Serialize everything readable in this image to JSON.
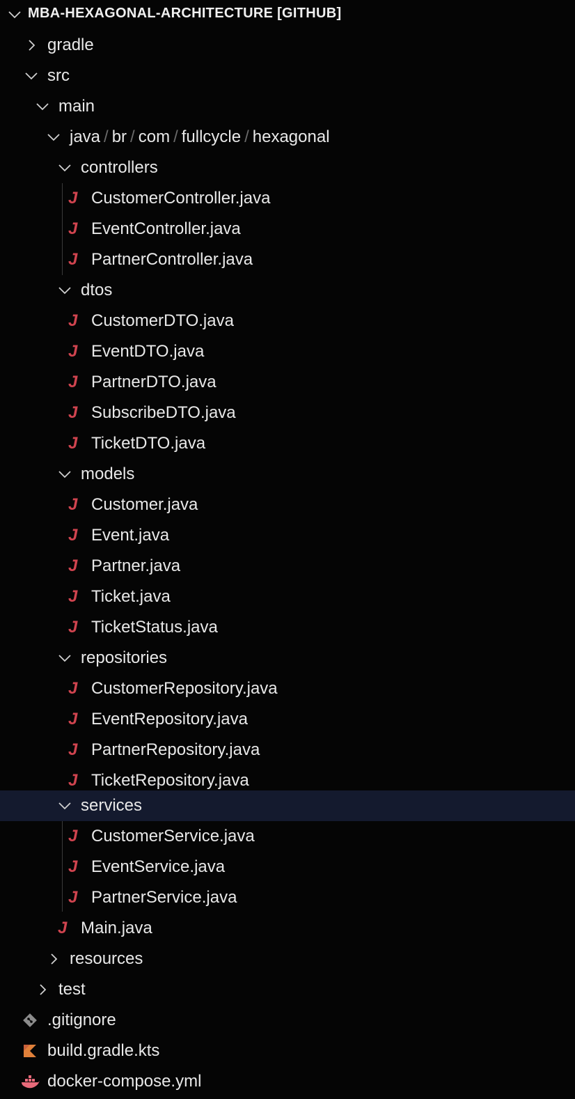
{
  "header": {
    "title": "MBA-HEXAGONAL-ARCHITECTURE [GITHUB]",
    "icon": "chevron-down-icon"
  },
  "colors": {
    "background": "#050505",
    "selected_row": "#141a2e",
    "java_icon": "#d0444f",
    "kotlin_icon": "#e0803a",
    "docker_icon": "#e86a7a"
  },
  "tree": {
    "gradle": "gradle",
    "src": "src",
    "main": "main",
    "java_path": [
      "java",
      "br",
      "com",
      "fullcycle",
      "hexagonal"
    ],
    "controllers": {
      "label": "controllers",
      "files": [
        "CustomerController.java",
        "EventController.java",
        "PartnerController.java"
      ]
    },
    "dtos": {
      "label": "dtos",
      "files": [
        "CustomerDTO.java",
        "EventDTO.java",
        "PartnerDTO.java",
        "SubscribeDTO.java",
        "TicketDTO.java"
      ]
    },
    "models": {
      "label": "models",
      "files": [
        "Customer.java",
        "Event.java",
        "Partner.java",
        "Ticket.java",
        "TicketStatus.java"
      ]
    },
    "repositories": {
      "label": "repositories",
      "files": [
        "CustomerRepository.java",
        "EventRepository.java",
        "PartnerRepository.java",
        "TicketRepository.java"
      ]
    },
    "services": {
      "label": "services",
      "files": [
        "CustomerService.java",
        "EventService.java",
        "PartnerService.java"
      ]
    },
    "main_java": "Main.java",
    "resources": "resources",
    "test": "test",
    "gitignore": ".gitignore",
    "build_gradle": "build.gradle.kts",
    "docker_compose": "docker-compose.yml"
  },
  "java_icon_glyph": "J"
}
